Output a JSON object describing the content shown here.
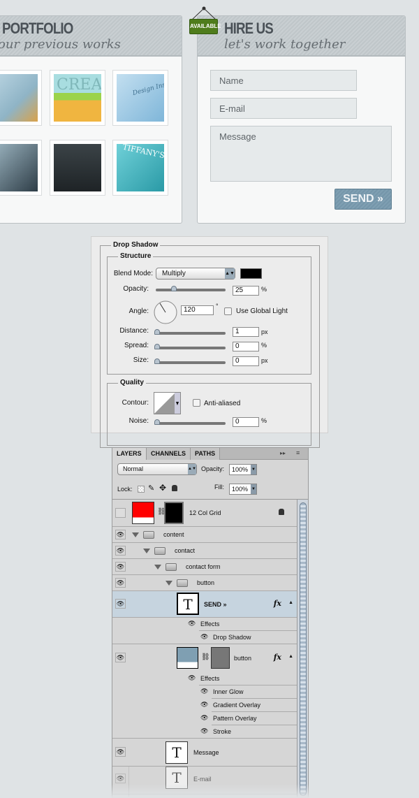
{
  "portfolio": {
    "title": "PORTFOLIO",
    "subtitle": "our previous works",
    "thumbnails": [
      "Portfolio site",
      "CREAT",
      "Design Instruct",
      "Portrait",
      "Dark site",
      "TIFFANY'S"
    ]
  },
  "hire": {
    "badge": "AVAILABLE",
    "title": "HIRE US",
    "subtitle": "let's work together",
    "name_placeholder": "Name",
    "email_placeholder": "E-mail",
    "message_placeholder": "Message",
    "send_label": "SEND »"
  },
  "drop_shadow": {
    "title": "Drop Shadow",
    "structure": "Structure",
    "blend_mode_label": "Blend Mode:",
    "blend_mode": "Multiply",
    "color": "#000000",
    "opacity_label": "Opacity:",
    "opacity": "25",
    "opacity_unit": "%",
    "angle_label": "Angle:",
    "angle": "120",
    "angle_unit": "°",
    "global_light": "Use Global Light",
    "distance_label": "Distance:",
    "distance": "1",
    "distance_unit": "px",
    "spread_label": "Spread:",
    "spread": "0",
    "spread_unit": "%",
    "size_label": "Size:",
    "size": "0",
    "size_unit": "px",
    "quality": "Quality",
    "contour_label": "Contour:",
    "anti_aliased": "Anti-aliased",
    "noise_label": "Noise:",
    "noise": "0",
    "noise_unit": "%"
  },
  "layers": {
    "tabs": [
      "LAYERS",
      "CHANNELS",
      "PATHS"
    ],
    "blend": "Normal",
    "opacity_label": "Opacity:",
    "opacity": "100%",
    "lock_label": "Lock:",
    "fill_label": "Fill:",
    "fill": "100%",
    "rows": [
      "12 Col Grid",
      "content",
      "contact",
      "contact form",
      "button",
      "SEND »",
      "Effects",
      "Drop Shadow",
      "button",
      "Effects",
      "Inner Glow",
      "Gradient Overlay",
      "Pattern Overlay",
      "Stroke",
      "Message",
      "E-mail"
    ],
    "fx": "fx",
    "selected_color": "#c6d4df"
  }
}
